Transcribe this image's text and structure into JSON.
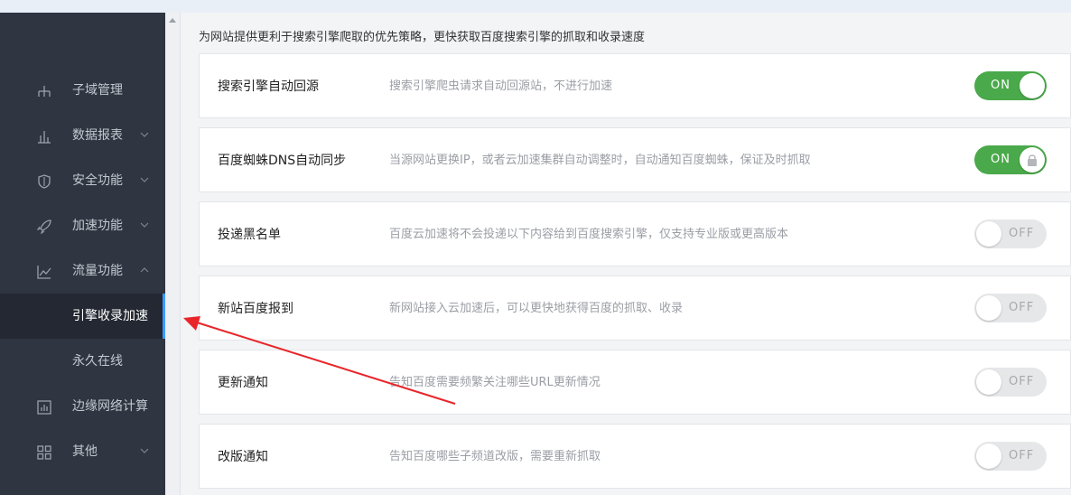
{
  "sidebar": {
    "items": [
      {
        "label": "子域管理",
        "icon": "sitemap-icon",
        "chevron": ""
      },
      {
        "label": "数据报表",
        "icon": "bar-chart-icon",
        "chevron": "down"
      },
      {
        "label": "安全功能",
        "icon": "shield-icon",
        "chevron": "down"
      },
      {
        "label": "加速功能",
        "icon": "rocket-icon",
        "chevron": "down"
      },
      {
        "label": "流量功能",
        "icon": "line-chart-icon",
        "chevron": "up"
      },
      {
        "label": "引擎收录加速",
        "icon": "",
        "chevron": "",
        "active": true
      },
      {
        "label": "永久在线",
        "icon": "",
        "chevron": ""
      },
      {
        "label": "边缘网络计算",
        "icon": "edge-compute-icon",
        "chevron": ""
      },
      {
        "label": "其他",
        "icon": "grid-icon",
        "chevron": "down"
      }
    ]
  },
  "main": {
    "intro": "为网站提供更利于搜索引擎爬取的优先策略，更快获取百度搜索引擎的抓取和收录速度",
    "settings": [
      {
        "title": "搜索引擎自动回源",
        "desc": "搜索引擎爬虫请求自动回源站，不进行加速",
        "state": "ON",
        "locked": false
      },
      {
        "title": "百度蜘蛛DNS自动同步",
        "desc": "当源网站更换IP，或者云加速集群自动调整时，自动通知百度蜘蛛，保证及时抓取",
        "state": "ON",
        "locked": true
      },
      {
        "title": "投递黑名单",
        "desc": "百度云加速将不会投递以下内容给到百度搜索引擎，仅支持专业版或更高版本",
        "state": "OFF",
        "locked": false
      },
      {
        "title": "新站百度报到",
        "desc": "新网站接入云加速后，可以更快地获得百度的抓取、收录",
        "state": "OFF",
        "locked": false
      },
      {
        "title": "更新通知",
        "desc": "告知百度需要频繁关注哪些URL更新情况",
        "state": "OFF",
        "locked": false
      },
      {
        "title": "改版通知",
        "desc": "告知百度哪些子频道改版，需要重新抓取",
        "state": "OFF",
        "locked": false
      }
    ]
  },
  "colors": {
    "sidebar_bg": "#2f3541",
    "active_bg": "#232832",
    "accent": "#3b9cff",
    "toggle_on": "#4aa94a",
    "toggle_off": "#e6e7e9",
    "annotation_arrow": "#e8262a"
  }
}
